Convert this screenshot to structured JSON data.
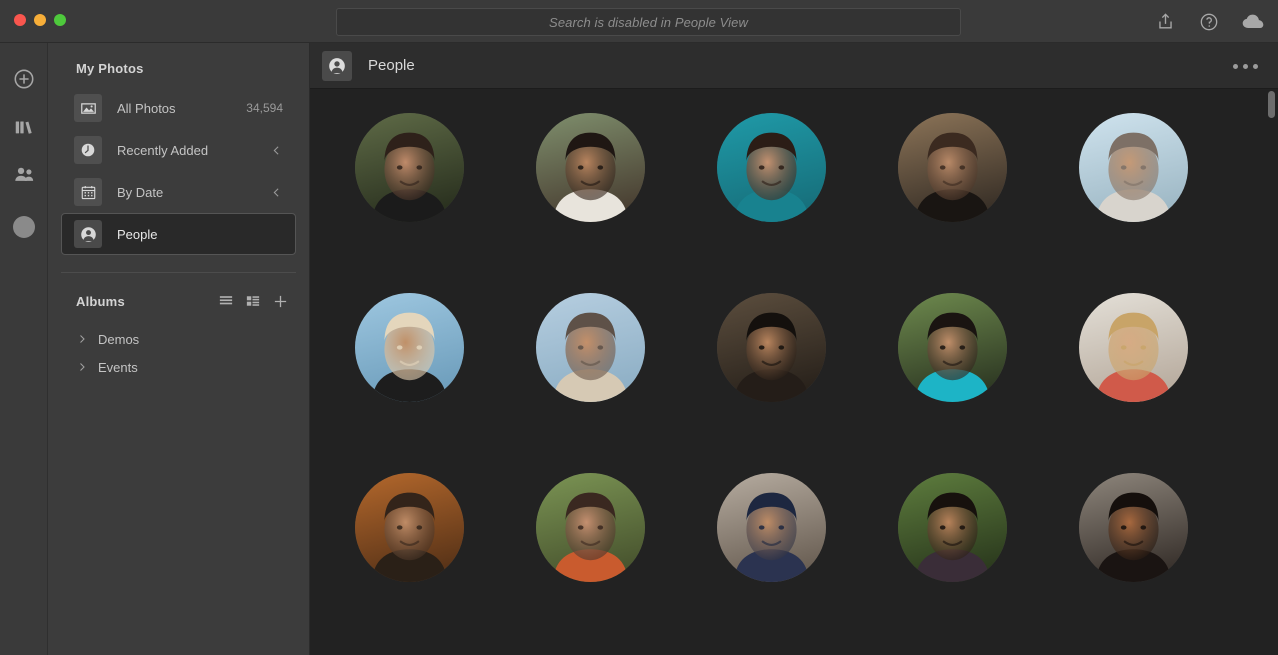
{
  "window": {
    "traffic_lights": [
      {
        "name": "close",
        "color": "#f9564e"
      },
      {
        "name": "minimize",
        "color": "#f7ae39"
      },
      {
        "name": "maximize",
        "color": "#4ec93c"
      }
    ]
  },
  "search": {
    "placeholder": "Search is disabled in People View",
    "value": "",
    "disabled": true
  },
  "titlebar_actions": [
    {
      "name": "share-icon",
      "label": "Share"
    },
    {
      "name": "help-icon",
      "label": "Help"
    },
    {
      "name": "cloud-icon",
      "label": "Cloud Sync"
    }
  ],
  "rail": {
    "items": [
      {
        "name": "add-icon",
        "label": "Add"
      },
      {
        "name": "library-icon",
        "label": "Library"
      },
      {
        "name": "people-icon",
        "label": "People"
      },
      {
        "name": "account-avatar",
        "label": "Account"
      }
    ]
  },
  "sidebar": {
    "title": "My Photos",
    "items": [
      {
        "label": "All Photos",
        "icon": "photo-icon",
        "count": "34,594",
        "chevron": false,
        "selected": false
      },
      {
        "label": "Recently Added",
        "icon": "clock-icon",
        "count": "",
        "chevron": true,
        "selected": false
      },
      {
        "label": "By Date",
        "icon": "calendar-icon",
        "count": "",
        "chevron": true,
        "selected": false
      },
      {
        "label": "People",
        "icon": "person-icon",
        "count": "",
        "chevron": false,
        "selected": true
      }
    ],
    "albums": {
      "title": "Albums",
      "actions": [
        {
          "name": "list-view-icon",
          "label": "List View"
        },
        {
          "name": "grid-view-icon",
          "label": "Grid View"
        },
        {
          "name": "add-album-icon",
          "label": "Add Album"
        }
      ],
      "entries": [
        {
          "label": "Demos",
          "expanded": false
        },
        {
          "label": "Events",
          "expanded": false
        }
      ]
    }
  },
  "content": {
    "header": {
      "icon": "person-icon",
      "title": "People",
      "overflow": "more-options"
    },
    "people": [
      {
        "id": 1,
        "bg_top": "#5f6b47",
        "bg_bottom": "#2b3220",
        "skin": "#c08b6a",
        "hair": "#2e211a",
        "shirt": "#1b1b1b"
      },
      {
        "id": 2,
        "bg_top": "#7f8f6d",
        "bg_bottom": "#4a4033",
        "skin": "#b9855f",
        "hair": "#1f1713",
        "shirt": "#e8e4dc"
      },
      {
        "id": 3,
        "bg_top": "#1f9aa8",
        "bg_bottom": "#17707c",
        "skin": "#c49271",
        "hair": "#2b1d16",
        "shirt": "#18828f"
      },
      {
        "id": 4,
        "bg_top": "#8c7458",
        "bg_bottom": "#3a3128",
        "skin": "#b98a68",
        "hair": "#3b2a20",
        "shirt": "#191512"
      },
      {
        "id": 5,
        "bg_top": "#cfe3ee",
        "bg_bottom": "#9fb9c6",
        "skin": "#c59a77",
        "hair": "#7d7066",
        "shirt": "#d8d4cd"
      },
      {
        "id": 6,
        "bg_top": "#9ec7e0",
        "bg_bottom": "#6f9fbd",
        "skin": "#c09068",
        "hair": "#e4d6bc",
        "shirt": "#1d1d1d"
      },
      {
        "id": 7,
        "bg_top": "#b6cee0",
        "bg_bottom": "#8fb0c6",
        "skin": "#c4906a",
        "hair": "#5e5148",
        "shirt": "#d6c9b4"
      },
      {
        "id": 8,
        "bg_top": "#5c4e3e",
        "bg_bottom": "#2a231c",
        "skin": "#b9855e",
        "hair": "#14100d",
        "shirt": "#241d18"
      },
      {
        "id": 9,
        "bg_top": "#6e8a4e",
        "bg_bottom": "#2f3a24",
        "skin": "#c08f6a",
        "hair": "#1a1411",
        "shirt": "#1db4c6"
      },
      {
        "id": 10,
        "bg_top": "#e4e0d8",
        "bg_bottom": "#b9ada0",
        "skin": "#d6ab85",
        "hair": "#c8a468",
        "shirt": "#d05a4a"
      },
      {
        "id": 11,
        "bg_top": "#b4682c",
        "bg_bottom": "#5a3418",
        "skin": "#c08c66",
        "hair": "#33241a",
        "shirt": "#2a2017"
      },
      {
        "id": 12,
        "bg_top": "#7b9454",
        "bg_bottom": "#49552f",
        "skin": "#c59070",
        "hair": "#3a2820",
        "shirt": "#c95b2e"
      },
      {
        "id": 13,
        "bg_top": "#b6aca0",
        "bg_bottom": "#6b6055",
        "skin": "#bf8d66",
        "hair": "#1d2740",
        "shirt": "#2b3350"
      },
      {
        "id": 14,
        "bg_top": "#5e7d3e",
        "bg_bottom": "#2c3b1e",
        "skin": "#b8835b",
        "hair": "#17110d",
        "shirt": "#3a2d38"
      },
      {
        "id": 15,
        "bg_top": "#8e867c",
        "bg_bottom": "#3a332e",
        "skin": "#a8693f",
        "hair": "#150f0c",
        "shirt": "#1a1412"
      }
    ]
  }
}
